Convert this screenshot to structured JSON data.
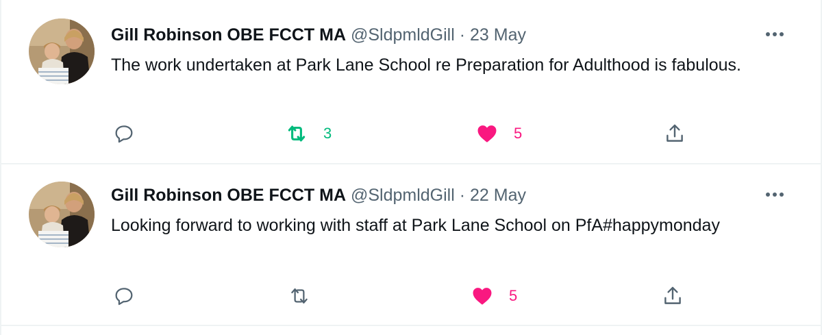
{
  "tweets": [
    {
      "author": {
        "name": "Gill Robinson OBE FCCT MA",
        "handle": "@SldpmldGill",
        "avatar_icon": "profile-photo-avatar"
      },
      "separator": "·",
      "date": "23 May",
      "text": "The work undertaken at Park Lane School re Preparation for Adulthood is fabulous.",
      "actions": {
        "reply_count": "",
        "retweet_count": "3",
        "like_count": "5"
      },
      "retweeted": true,
      "liked": true
    },
    {
      "author": {
        "name": "Gill Robinson OBE FCCT MA",
        "handle": "@SldpmldGill",
        "avatar_icon": "profile-photo-avatar"
      },
      "separator": "·",
      "date": "22 May",
      "text": "Looking forward to working with staff at Park Lane School on PfA#happymonday",
      "actions": {
        "reply_count": "",
        "retweet_count": "",
        "like_count": "5"
      },
      "retweeted": false,
      "liked": true
    }
  ],
  "colors": {
    "text_primary": "#0f1419",
    "text_secondary": "#536471",
    "retweet_active": "#00ba7c",
    "like_active": "#f91880",
    "divider": "#eff3f4"
  },
  "icons": {
    "more": "more-dots-icon",
    "reply": "reply-bubble-icon",
    "retweet": "retweet-arrows-icon",
    "like": "heart-icon",
    "share": "share-upload-icon"
  }
}
